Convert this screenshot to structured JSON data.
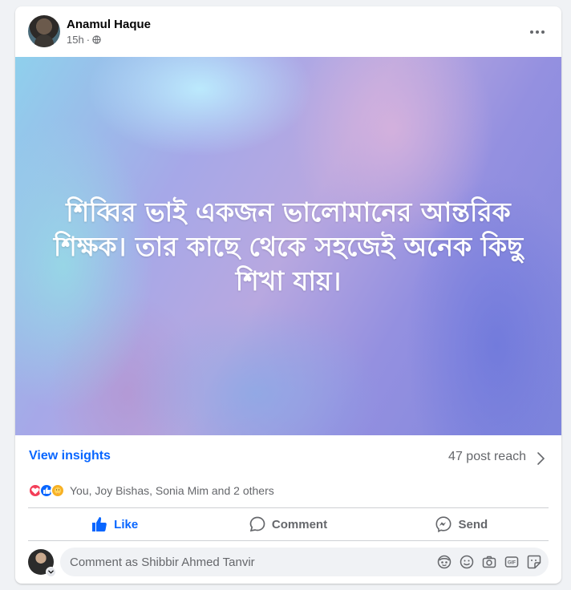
{
  "post": {
    "author": "Anamul Haque",
    "time": "15h",
    "separator": "·",
    "privacy_icon": "globe-icon",
    "text": "শিব্বির ভাই একজন ভালোমানের আন্তরিক শিক্ষক। তার কাছে থেকে সহজেই অনেক কিছু শিখা যায়।"
  },
  "insights": {
    "view_label": "View insights",
    "reach_label": "47 post reach"
  },
  "reactions": {
    "icons": [
      "love-icon",
      "like-icon",
      "care-icon"
    ],
    "summary": "You, Joy Bishas, Sonia Mim and 2 others"
  },
  "actions": {
    "like_label": "Like",
    "comment_label": "Comment",
    "send_label": "Send"
  },
  "comment": {
    "placeholder": "Comment as Shibbir Ahmed Tanvir",
    "tools": [
      "avatar-sticker-icon",
      "emoji-icon",
      "camera-icon",
      "gif-icon",
      "sticker-icon"
    ]
  },
  "colors": {
    "accent": "#0866ff",
    "secondary_text": "#65676b",
    "divider": "#ced0d4"
  }
}
